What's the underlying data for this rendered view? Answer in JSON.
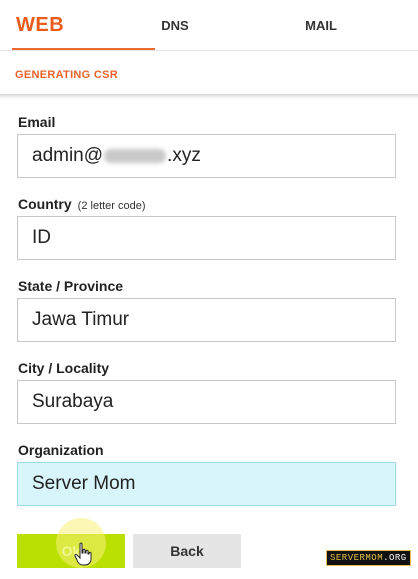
{
  "tabs": [
    {
      "label": "WEB",
      "active": true
    },
    {
      "label": "DNS",
      "active": false
    },
    {
      "label": "MAIL",
      "active": false
    }
  ],
  "subheader": {
    "title": "GENERATING CSR"
  },
  "colors": {
    "accent": "#ea5b1c",
    "ok_button": "#b9e000",
    "focus_bg": "#d8f5fb"
  },
  "fields": {
    "email": {
      "label": "Email",
      "value_prefix": "admin@",
      "value_suffix": ".xyz"
    },
    "country": {
      "label": "Country",
      "hint": "(2 letter code)",
      "value": "ID"
    },
    "state": {
      "label": "State / Province",
      "value": "Jawa Timur"
    },
    "city": {
      "label": "City / Locality",
      "value": "Surabaya"
    },
    "organization": {
      "label": "Organization",
      "value": "Server Mom"
    }
  },
  "buttons": {
    "ok": "Ok",
    "back": "Back"
  },
  "watermark": {
    "brand": "SERVERMOM",
    "tld": ".ORG"
  }
}
